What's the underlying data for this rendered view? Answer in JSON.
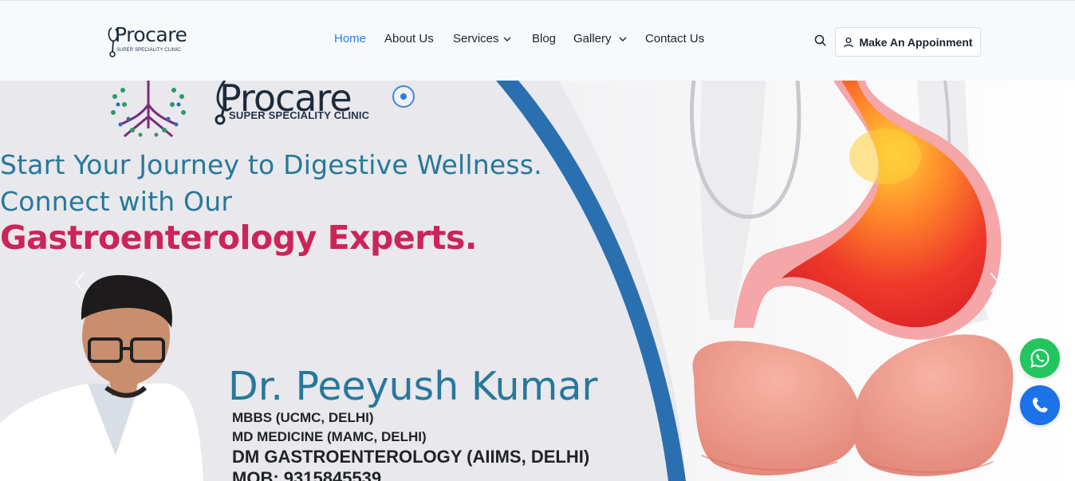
{
  "header": {
    "logo": {
      "name": "Procare",
      "tagline": "SUPER SPECIALITY CLINIC"
    },
    "nav": [
      {
        "label": "Home",
        "active": true,
        "dropdown": false
      },
      {
        "label": "About Us",
        "active": false,
        "dropdown": false
      },
      {
        "label": "Services",
        "active": false,
        "dropdown": true
      },
      {
        "label": "Blog",
        "active": false,
        "dropdown": false
      },
      {
        "label": "Gallery",
        "active": false,
        "dropdown": true
      },
      {
        "label": "Contact Us",
        "active": false,
        "dropdown": false
      }
    ],
    "search_icon": "search-icon",
    "appointment_button": {
      "label": "Make An Appoinment",
      "icon": "user-icon"
    }
  },
  "hero": {
    "brand": {
      "name": "Procare",
      "tagline": "SUPER SPECIALITY CLINIC"
    },
    "headline_line1": "Start Your Journey to Digestive Wellness.",
    "headline_line2": "Connect with Our",
    "headline_line3": "Gastroenterology Experts.",
    "doctor_name": "Dr. Peeyush Kumar",
    "credentials": [
      "MBBS (UCMC, DELHI)",
      "MD MEDICINE (MAMC, DELHI)",
      "DM GASTROENTEROLOGY (AIIMS, DELHI)",
      "MOB: 9315845539"
    ],
    "prev_icon": "chevron-left-icon",
    "next_icon": "chevron-right-icon"
  },
  "floating": {
    "whatsapp_icon": "whatsapp-icon",
    "call_icon": "phone-icon"
  },
  "colors": {
    "accent": "#2c7be5",
    "headline_teal": "#27789a",
    "headline_red": "#cc2459",
    "whatsapp": "#23c55e",
    "call": "#1c72e8"
  }
}
